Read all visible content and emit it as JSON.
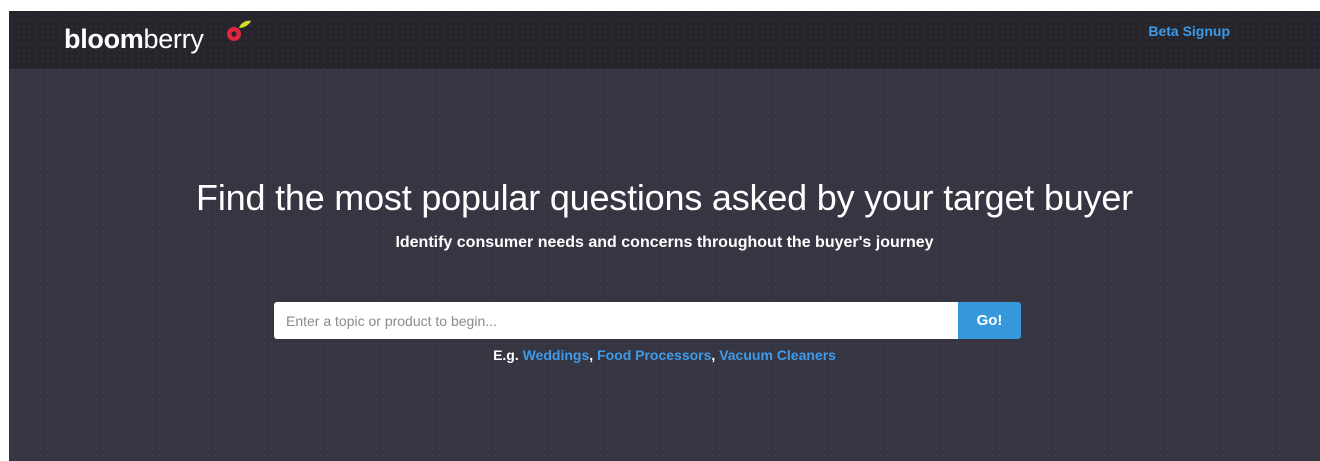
{
  "header": {
    "logo_bold": "bloom",
    "logo_light": "berry",
    "beta_signup": "Beta Signup"
  },
  "hero": {
    "title": "Find the most popular questions asked by your target buyer",
    "subtitle": "Identify consumer needs and concerns throughout the buyer's journey"
  },
  "search": {
    "placeholder": "Enter a topic or product to begin...",
    "value": "",
    "button_label": "Go!"
  },
  "examples": {
    "prefix": "E.g.",
    "separator": ",",
    "items": [
      "Weddings",
      "Food Processors",
      "Vacuum Cleaners"
    ]
  },
  "colors": {
    "page_bg": "#363642",
    "topbar_bg": "#25252b",
    "accent": "#3498db",
    "link": "#3d9be9",
    "logo_berry_red": "#e0263f",
    "logo_leaf_yellow": "#d7e025"
  }
}
